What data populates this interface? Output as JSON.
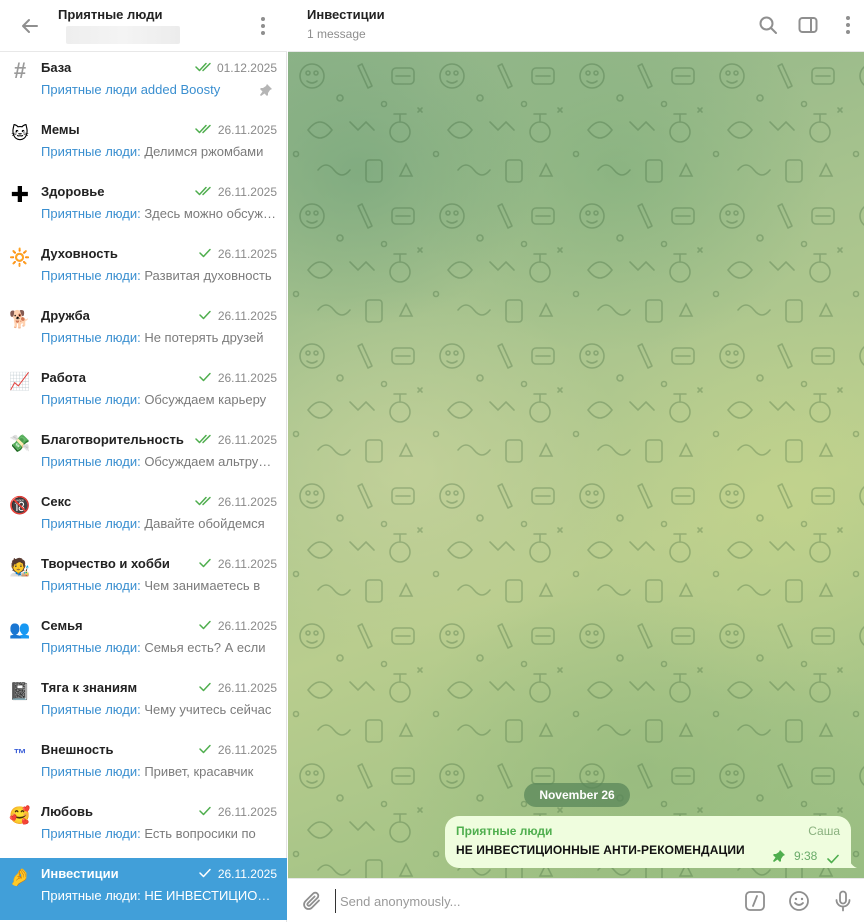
{
  "left_header": {
    "title": "Приятные люди",
    "subtitle": ""
  },
  "topics": [
    {
      "icon": "hash-icon",
      "glyph": "#",
      "name": "База",
      "date": "01.12.2025",
      "checks": "double",
      "sender": "Приятные люди added Boosty",
      "text": "",
      "pinned": true,
      "active": false
    },
    {
      "icon": "cat-icon",
      "glyph": "🐱",
      "name": "Мемы",
      "date": "26.11.2025",
      "checks": "double",
      "sender": "Приятные люди:",
      "text": " Делимся ржомбами",
      "pinned": false,
      "active": false
    },
    {
      "icon": "cross-icon",
      "glyph": "✚",
      "name": "Здоровье",
      "date": "26.11.2025",
      "checks": "double",
      "sender": "Приятные люди:",
      "text": " Здесь можно обсуждать",
      "pinned": false,
      "active": false
    },
    {
      "icon": "sun-icon",
      "glyph": "🔆",
      "name": "Духовность",
      "date": "26.11.2025",
      "checks": "single",
      "sender": "Приятные люди:",
      "text": " Развитая духовность",
      "pinned": false,
      "active": false
    },
    {
      "icon": "dog-icon",
      "glyph": "🐕",
      "name": "Дружба",
      "date": "26.11.2025",
      "checks": "single",
      "sender": "Приятные люди:",
      "text": " Не потерять друзей",
      "pinned": false,
      "active": false
    },
    {
      "icon": "chart-icon",
      "glyph": "📈",
      "name": "Работа",
      "date": "26.11.2025",
      "checks": "single",
      "sender": "Приятные люди:",
      "text": " Обсуждаем карьеру",
      "pinned": false,
      "active": false
    },
    {
      "icon": "money-icon",
      "glyph": "💸",
      "name": "Благотворительность",
      "date": "26.11.2025",
      "checks": "double",
      "sender": "Приятные люди:",
      "text": " Обсуждаем альтруизм",
      "pinned": false,
      "active": false
    },
    {
      "icon": "adult-icon",
      "glyph": "🔞",
      "name": "Секс",
      "date": "26.11.2025",
      "checks": "double",
      "sender": "Приятные люди:",
      "text": " Давайте обойдемся",
      "pinned": false,
      "active": false
    },
    {
      "icon": "artist-icon",
      "glyph": "🧑‍🎨",
      "name": "Творчество и хобби",
      "date": "26.11.2025",
      "checks": "single",
      "sender": "Приятные люди:",
      "text": " Чем занимаетесь в",
      "pinned": false,
      "active": false
    },
    {
      "icon": "family-icon",
      "glyph": "👥",
      "name": "Семья",
      "date": "26.11.2025",
      "checks": "single",
      "sender": "Приятные люди:",
      "text": " Семья есть? А если",
      "pinned": false,
      "active": false
    },
    {
      "icon": "book-icon",
      "glyph": "📓",
      "name": "Тяга к знаниям",
      "date": "26.11.2025",
      "checks": "single",
      "sender": "Приятные люди:",
      "text": " Чему учитесь сейчас",
      "pinned": false,
      "active": false
    },
    {
      "icon": "sticker-icon",
      "glyph": "™",
      "name": "Внешность",
      "date": "26.11.2025",
      "checks": "single",
      "sender": "Приятные люди:",
      "text": " Привет, красавчик",
      "pinned": false,
      "active": false
    },
    {
      "icon": "love-face-icon",
      "glyph": "🥰",
      "name": "Любовь",
      "date": "26.11.2025",
      "checks": "single",
      "sender": "Приятные люди:",
      "text": " Есть вопросики по",
      "pinned": false,
      "active": false
    },
    {
      "icon": "pinch-hand-icon",
      "glyph": "🤌",
      "name": "Инвестиции",
      "date": "26.11.2025",
      "checks": "single",
      "sender": "Приятные люди:",
      "text": " НЕ ИНВЕСТИЦИОННЫЕ",
      "pinned": false,
      "active": true
    }
  ],
  "chat": {
    "title": "Инвестиции",
    "subtitle": "1 message",
    "date_badge": "November 26",
    "message": {
      "sender": "Приятные люди",
      "author": "Саша",
      "text": "НЕ ИНВЕСТИЦИОННЫЕ АНТИ-РЕКОМЕНДАЦИИ",
      "time": "9:38"
    },
    "composer_placeholder": "Send anonymously..."
  },
  "colors": {
    "accent": "#419fd9",
    "sender": "#3a8fd0",
    "check": "#4fae4e",
    "bubble": "#effdde"
  }
}
